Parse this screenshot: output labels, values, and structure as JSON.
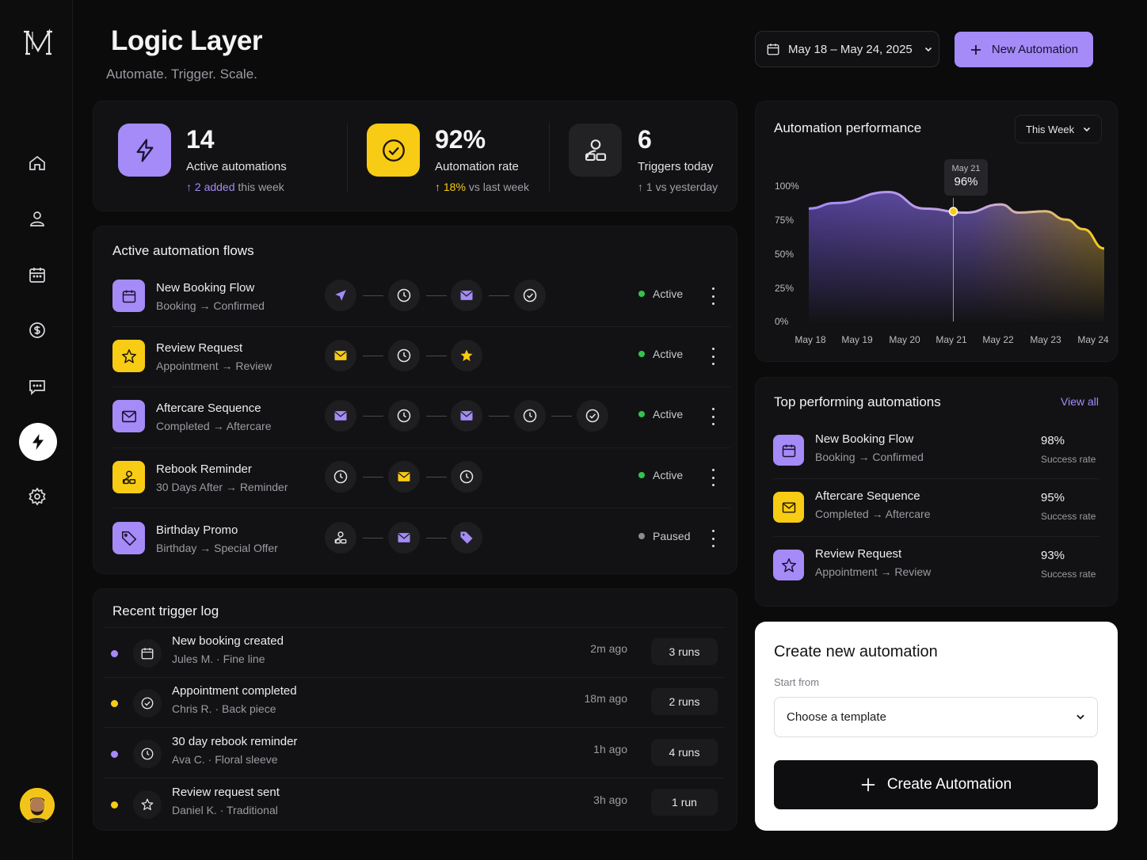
{
  "app": {
    "title": "Logic Layer",
    "subtitle": "Automate. Trigger. Scale."
  },
  "sidebar": {
    "items": [
      {
        "icon": "home-icon"
      },
      {
        "icon": "user-icon"
      },
      {
        "icon": "calendar-icon"
      },
      {
        "icon": "dollar-icon"
      },
      {
        "icon": "chat-icon"
      },
      {
        "icon": "lightning-icon",
        "active": true
      },
      {
        "icon": "gear-icon"
      }
    ]
  },
  "header": {
    "date_range": "May 18 – May 24, 2025",
    "new_button": "New Automation"
  },
  "colors": {
    "purple": "#a48bf7",
    "yellow": "#f8cb14",
    "green": "#33c24d",
    "gray": "#8a8a90"
  },
  "stats": [
    {
      "value": "14",
      "label": "Active automations",
      "delta": "2 added",
      "delta_suffix": "this week",
      "icon": "lightning-icon"
    },
    {
      "value": "92%",
      "label": "Automation rate",
      "delta": "18%",
      "delta_suffix": "vs last week",
      "icon": "check-circle-icon"
    },
    {
      "value": "6",
      "label": "Triggers today",
      "delta": "1",
      "delta_suffix": "vs yesterday",
      "icon": "users-icon"
    }
  ],
  "flows": {
    "title": "Active automation flows",
    "rows": [
      {
        "name": "New Booking Flow",
        "sub": "Booking → Confirmed",
        "status": "Active"
      },
      {
        "name": "Review Request",
        "sub": "Appointment → Review",
        "status": "Active"
      },
      {
        "name": "Aftercare Sequence",
        "sub": "Completed → Aftercare",
        "status": "Active"
      },
      {
        "name": "Rebook Reminder",
        "sub": "30 Days After → Reminder",
        "status": "Active"
      },
      {
        "name": "Birthday Promo",
        "sub": "Birthday → Special Offer",
        "status": "Paused"
      }
    ]
  },
  "log": {
    "title": "Recent trigger log",
    "rows": [
      {
        "title": "New booking created",
        "sub": "Jules M. · Fine line",
        "time": "2m ago",
        "runs": "3 runs"
      },
      {
        "title": "Appointment completed",
        "sub": "Chris R. · Back piece",
        "time": "18m ago",
        "runs": "2 runs"
      },
      {
        "title": "30 day rebook reminder",
        "sub": "Ava C. · Floral sleeve",
        "time": "1h ago",
        "runs": "4 runs"
      },
      {
        "title": "Review request sent",
        "sub": "Daniel K. · Traditional",
        "time": "3h ago",
        "runs": "1 run"
      }
    ]
  },
  "performance": {
    "title": "Automation performance",
    "range": "This Week",
    "tooltip": {
      "date": "May 21",
      "value": "96%"
    }
  },
  "chart_data": {
    "type": "area",
    "x": [
      "May 18",
      "May 19",
      "May 20",
      "May 21",
      "May 22",
      "May 23",
      "May 24"
    ],
    "y_ticks": [
      "100%",
      "75%",
      "50%",
      "25%",
      "0%"
    ],
    "series": [
      {
        "values": [
          82,
          86,
          94,
          82,
          79,
          85,
          79,
          80,
          74,
          67,
          53
        ]
      }
    ],
    "series_x_fraction": [
      0,
      0.09,
      0.27,
      0.39,
      0.53,
      0.65,
      0.71,
      0.8,
      0.87,
      0.93,
      1
    ],
    "ylim": [
      0,
      100
    ],
    "highlight": {
      "x": "May 21",
      "value": "96%"
    }
  },
  "top": {
    "title": "Top performing automations",
    "view_all": "View all",
    "rows": [
      {
        "name": "New Booking Flow",
        "sub": "Booking → Confirmed",
        "pct": "98%",
        "caption": "Success rate"
      },
      {
        "name": "Aftercare Sequence",
        "sub": "Completed → Aftercare",
        "pct": "95%",
        "caption": "Success rate"
      },
      {
        "name": "Review Request",
        "sub": "Appointment → Review",
        "pct": "93%",
        "caption": "Success rate"
      }
    ]
  },
  "create": {
    "title": "Create new automation",
    "label": "Start from",
    "select_value": "Choose a template",
    "button": "Create Automation"
  }
}
